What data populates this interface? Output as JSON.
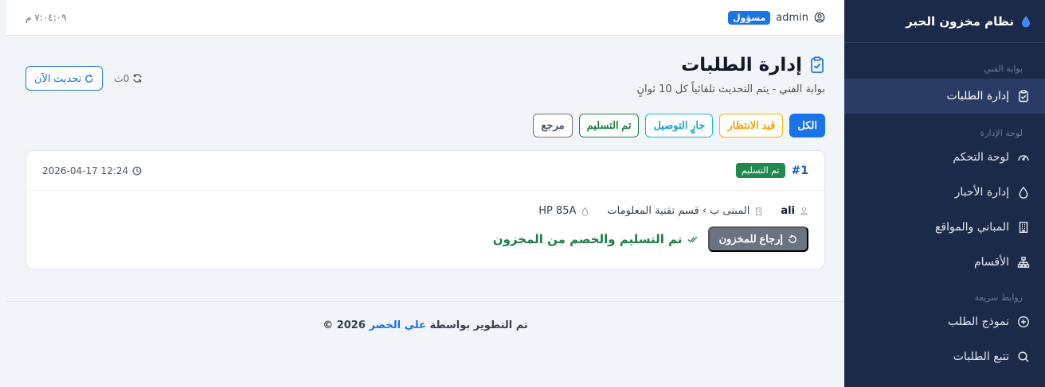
{
  "brand": {
    "title": "نظام مخزون الحبر",
    "icon": "droplet-icon"
  },
  "sidebar": {
    "sections": [
      {
        "label": "بوابة الفني",
        "items": [
          {
            "label": "إدارة الطلبات",
            "icon": "clipboard-check-icon",
            "active": true
          }
        ]
      },
      {
        "label": "لوحة الإدارة",
        "items": [
          {
            "label": "لوحة التحكم",
            "icon": "speedometer-icon"
          },
          {
            "label": "إدارة الأحبار",
            "icon": "droplet-icon"
          },
          {
            "label": "المباني والمواقع",
            "icon": "building-icon"
          },
          {
            "label": "الأقسام",
            "icon": "sitemap-icon"
          }
        ]
      },
      {
        "label": "روابط سريعة",
        "items": [
          {
            "label": "نموذج الطلب",
            "icon": "plus-circle-icon"
          },
          {
            "label": "تتبع الطلبات",
            "icon": "search-icon"
          }
        ]
      }
    ]
  },
  "topbar": {
    "user": "admin",
    "role": "مسؤول",
    "clock": "٧:٠٤:٠٩ م"
  },
  "page": {
    "title": "إدارة الطلبات",
    "subtitle": "بوابة الفني - يتم التحديث تلقائياً كل 10 ثوانٍ",
    "refresh_label": "تحديث الآن",
    "counter": "0ث"
  },
  "filters": [
    "الكل",
    "قيد الانتظار",
    "جارٍ التوصيل",
    "تم التسليم",
    "مرجع"
  ],
  "order": {
    "id": "#1",
    "status": "تم التسليم",
    "datetime": "2026-04-17 12:24",
    "user": "ali",
    "location": "المبنى ب › قسم تقنية المعلومات",
    "ink": "HP 85A",
    "return_label": "إرجاع للمخزون",
    "done_text": "تم التسليم والخصم من المخزون"
  },
  "footer": {
    "prefix": "تم التطوير بواسطة",
    "author": "علي الخضر",
    "year": "© 2026"
  },
  "colors": {
    "sidebar": "#1c2a4a",
    "accent": "#1a73e8",
    "success": "#1e8a4f",
    "warning": "#f0a500",
    "info": "#1aa3c6"
  }
}
